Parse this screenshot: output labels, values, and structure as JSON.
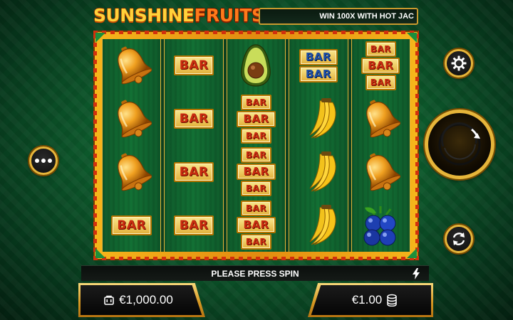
{
  "logo": {
    "word1": "SUNSHINE",
    "word2": "FRUITS"
  },
  "ticker": {
    "text": "WIN 100X WITH HOT JAC"
  },
  "reels": [
    [
      "bell-icon",
      "bell-icon",
      "bell-icon",
      "bar"
    ],
    [
      "bar",
      "bar",
      "bar",
      "bar"
    ],
    [
      "avocado-icon",
      "triple-bar",
      "triple-bar",
      "triple-bar"
    ],
    [
      "double-bar-blue",
      "banana-icon",
      "banana-icon",
      "banana-icon"
    ],
    [
      "triple-bar",
      "bell-icon",
      "bell-icon",
      "plums-icon"
    ]
  ],
  "bar_label": "BAR",
  "message": "PLEASE PRESS SPIN",
  "balance": {
    "value": "€1,000.00",
    "icon": "wallet-icon"
  },
  "bet": {
    "value": "€1.00",
    "icon": "coins-icon"
  },
  "colors": {
    "frame": "#f6b61b",
    "accent_red": "#d2300d",
    "background_green": "#0d5a2c",
    "gold_border": "#e6b53a"
  }
}
